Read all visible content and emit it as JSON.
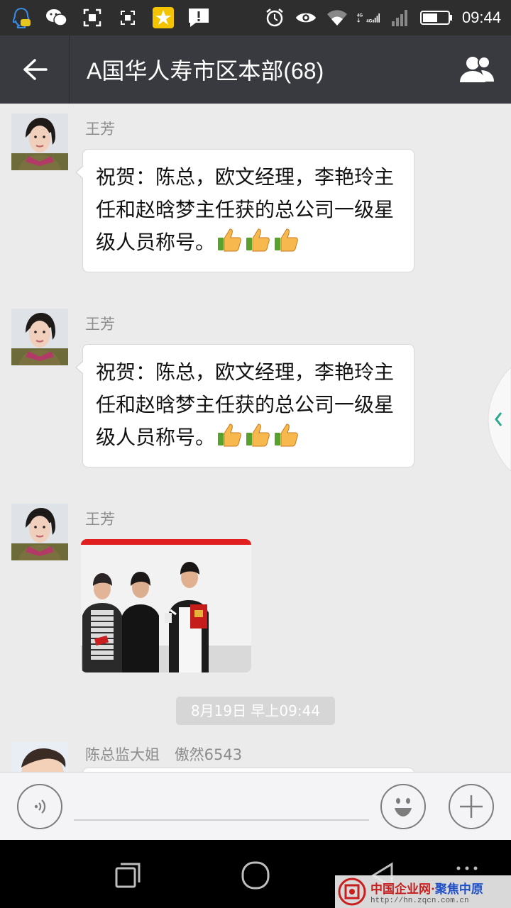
{
  "status_bar": {
    "time": "09:44",
    "network_a": "4G",
    "network_b": "4G"
  },
  "header": {
    "title": "A国华人寿市区本部(68)"
  },
  "messages": [
    {
      "sender": "王芳",
      "text": "祝贺：陈总，欧文经理，李艳玲主任和赵晗梦主任获的总公司一级星级人员称号。"
    },
    {
      "sender": "王芳",
      "text": "祝贺：陈总，欧文经理，李艳玲主任和赵晗梦主任获的总公司一级星级人员称号。"
    },
    {
      "sender": "王芳",
      "type": "image"
    }
  ],
  "timestamp": "8月19日 早上09:44",
  "last_message": {
    "sender": "陈总监大姐",
    "alias": "傲然6543"
  },
  "watermark": {
    "brand_a": "中国企业网",
    "sep": "·",
    "brand_b": "聚焦中原",
    "url": "http://hn.zqcn.com.cn"
  },
  "colors": {
    "header_bg": "#393a3f",
    "status_bg": "#2e2e2e",
    "chat_bg": "#ebebeb"
  }
}
